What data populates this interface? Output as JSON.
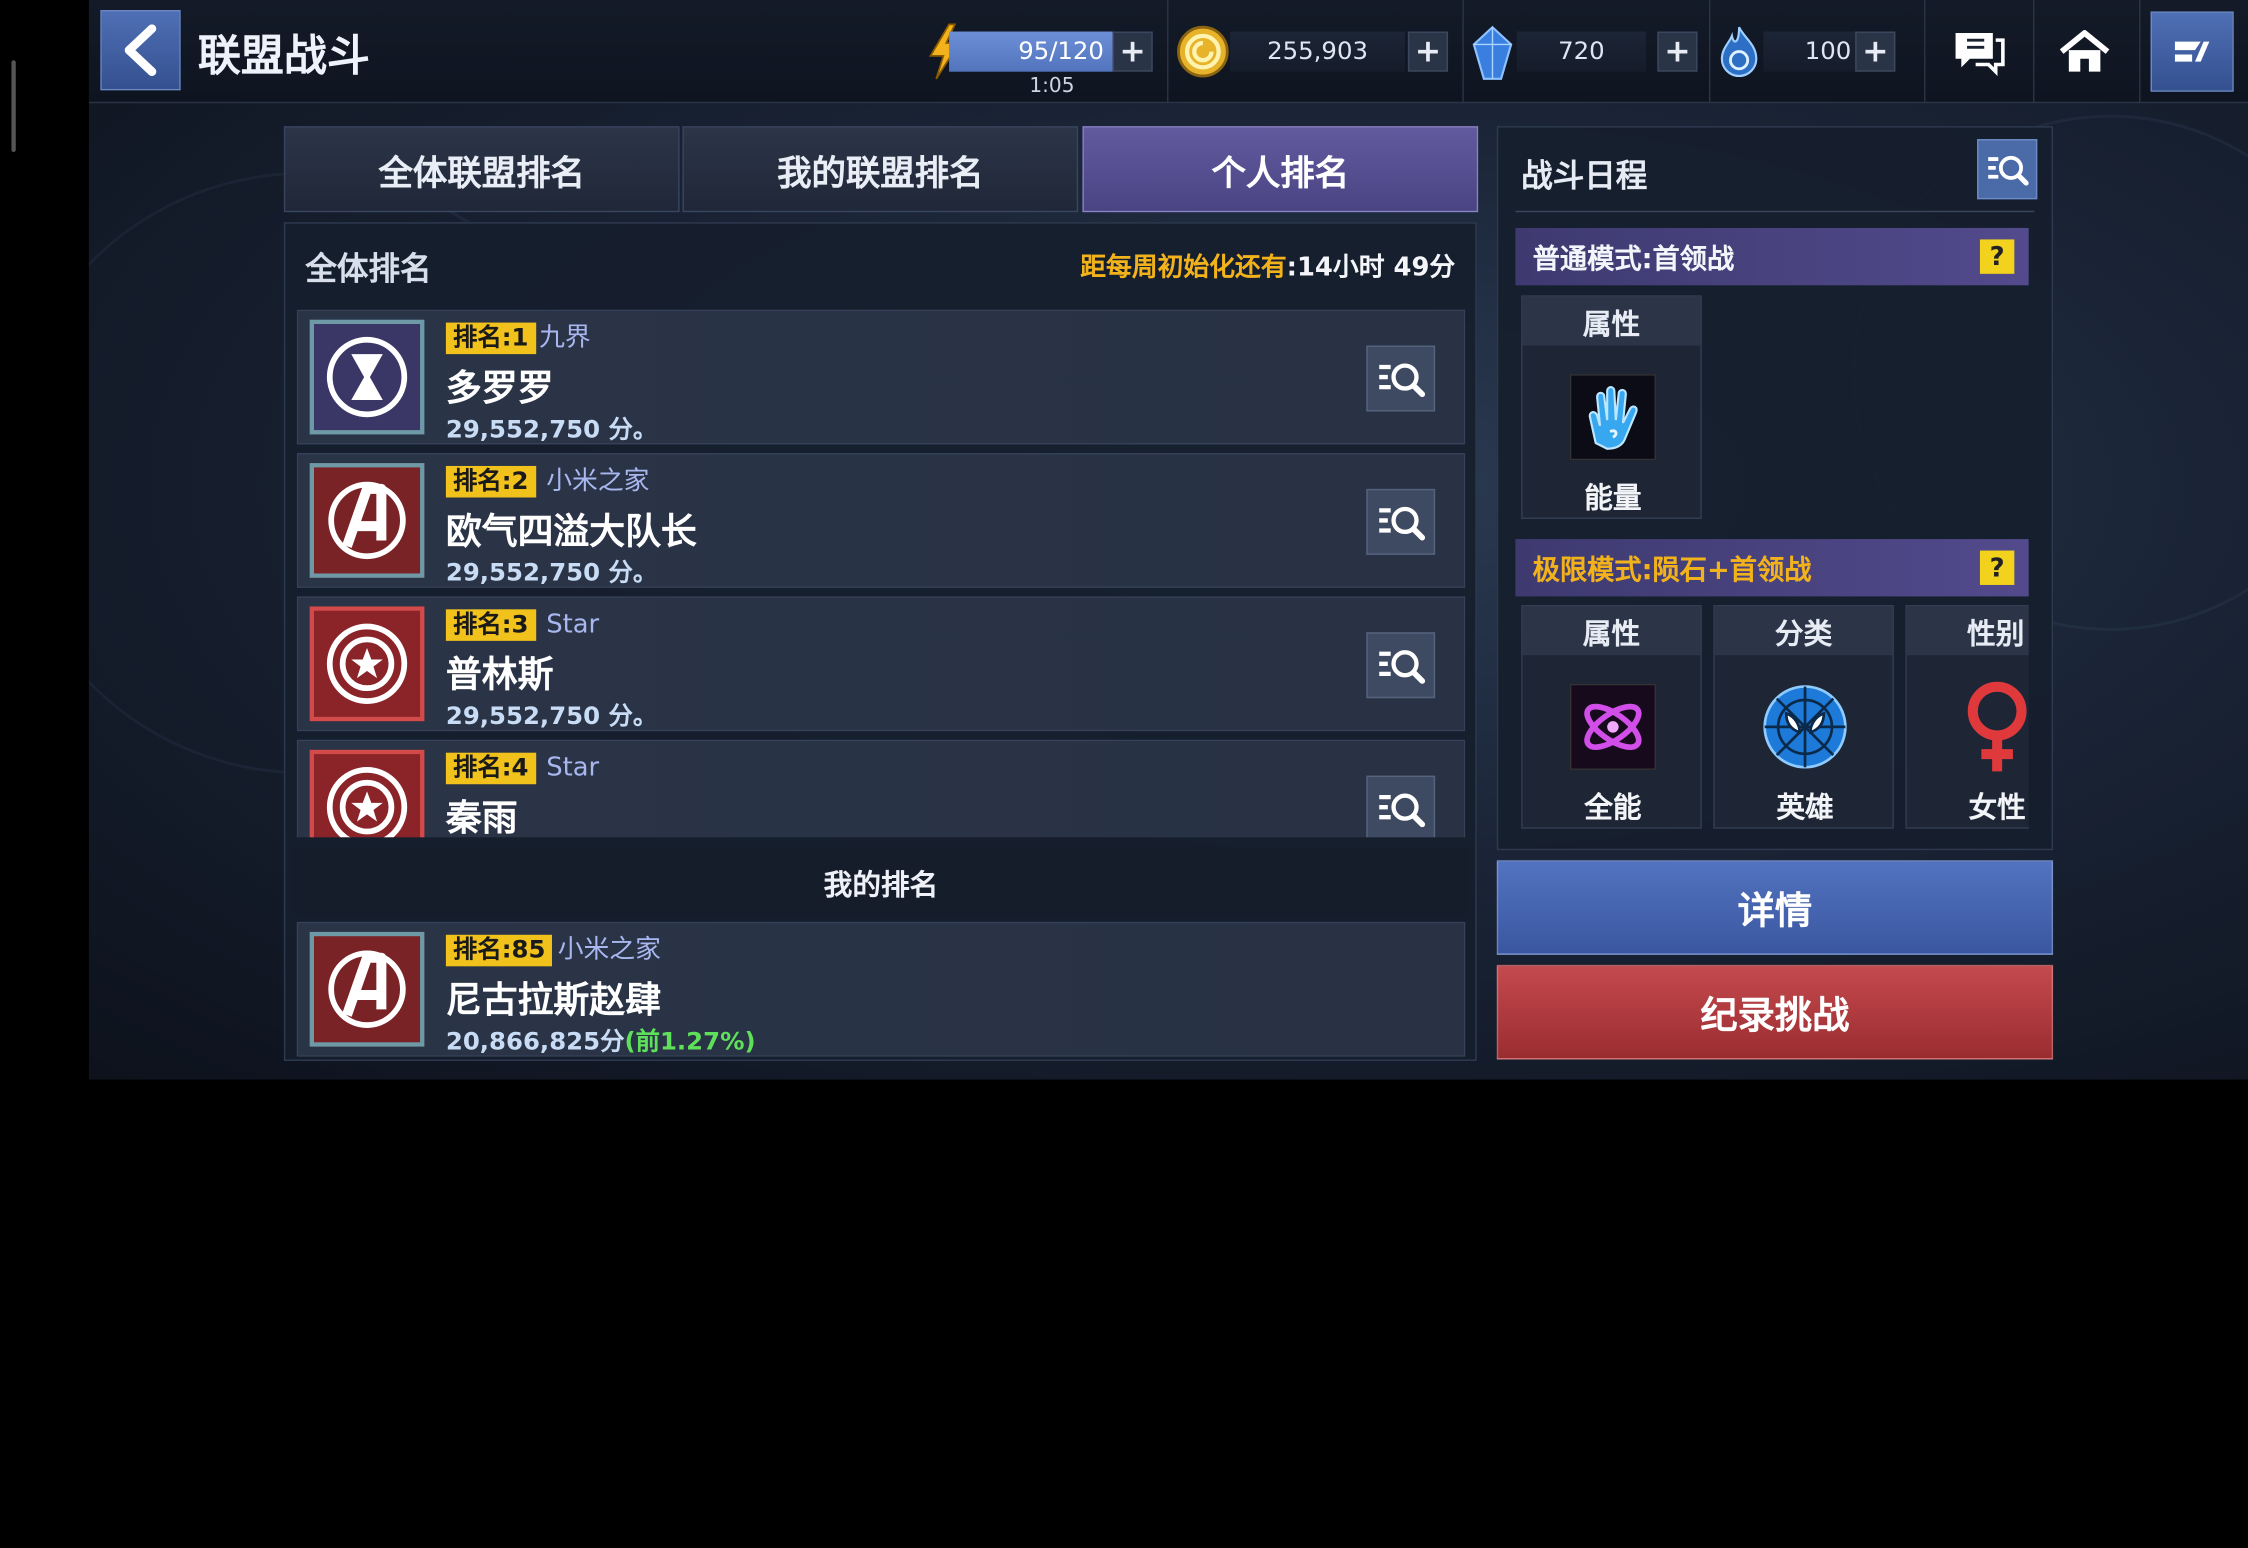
{
  "header": {
    "title": "联盟战斗",
    "energy": {
      "value": "95/120",
      "timer": "1:05"
    },
    "gold": "255,903",
    "crystal": "720",
    "stamina": "100"
  },
  "tabs": [
    {
      "label": "全体联盟排名",
      "active": false
    },
    {
      "label": "我的联盟排名",
      "active": false
    },
    {
      "label": "个人排名",
      "active": true
    }
  ],
  "ranking": {
    "title": "全体排名",
    "reset_label": "距每周初始化还有",
    "reset_value": ":14小时 49分",
    "rows": [
      {
        "rank": "排名:1",
        "alliance": "九界",
        "name": "多罗罗",
        "score": "29,552,750 分。",
        "emblem": "black-widow-emblem"
      },
      {
        "rank": "排名:2",
        "alliance": "小米之家",
        "name": "欧气四溢大队长",
        "score": "29,552,750 分。",
        "emblem": "avengers-emblem"
      },
      {
        "rank": "排名:3",
        "alliance": "Star",
        "name": "普林斯",
        "score": "29,552,750 分。",
        "emblem": "captain-america-shield-emblem"
      },
      {
        "rank": "排名:4",
        "alliance": "Star",
        "name": "秦雨",
        "score": "",
        "emblem": "captain-america-shield-emblem"
      }
    ],
    "my_rank_title": "我的排名",
    "my_rank": {
      "rank": "排名:85",
      "alliance": "小米之家",
      "name": "尼古拉斯赵肆",
      "score": "20,866,825分",
      "percent": "(前1.27%)",
      "emblem": "avengers-emblem"
    }
  },
  "schedule": {
    "title": "战斗日程",
    "normal": {
      "title": "普通模式:首领战",
      "attrs": [
        {
          "header": "属性",
          "label": "能量",
          "icon": "energy-hand-icon"
        }
      ]
    },
    "extreme": {
      "title": "极限模式:陨石+首领战",
      "attrs": [
        {
          "header": "属性",
          "label": "全能",
          "icon": "universal-icon"
        },
        {
          "header": "分类",
          "label": "英雄",
          "icon": "spider-hero-icon"
        },
        {
          "header": "性别",
          "label": "女性",
          "icon": "female-icon"
        }
      ]
    }
  },
  "buttons": {
    "details": "详情",
    "record": "纪录挑战"
  },
  "colors": {
    "accent_gold": "#f2c21c",
    "tab_active": "#554e90",
    "details_btn": "#3f5ea6",
    "record_btn": "#b03a3e",
    "percent_green": "#5fe05a"
  }
}
